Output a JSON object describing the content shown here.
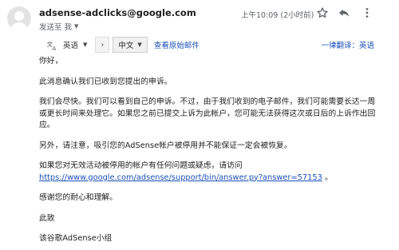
{
  "email": {
    "sender": "adsense-adclicks@google.com",
    "to_line": "发送至 我",
    "time": "上午10:09 (2小时前)"
  },
  "icons": {
    "star": "star-icon",
    "reply": "reply-icon",
    "more": "more-vert-icon",
    "translate": "translate-icon"
  },
  "translate_bar": {
    "source_lang": "英语",
    "arrow": "›",
    "target_lang": "中文",
    "show_original": "查看原始邮件",
    "always_translate": "一律翻译：英语"
  },
  "body": {
    "greeting": "你好，",
    "p1": "此消息确认我们已收到您提出的申诉。",
    "p2": "我们会尽快。我们可以看到自己的申诉。不过，由于我们收到的电子邮件，我们可能需要长达一周或更长时间来处理它。如果您之前已提交上诉为此帐户，您可能无法获得这次或日后的上诉作出回应。",
    "p3": "另外，请注意，吸引您的AdSense帐户被停用并不能保证一定会被恢复。",
    "p4": "如果您对无效活动被停用的帐户有任何问题或疑虑，请访问",
    "p4_link": "https://www.google.com/adsense/support/bin/answer.py?answer=57153",
    "p4_tail": " 。",
    "thanks": "感谢您的耐心和理解。",
    "closing": "此致",
    "signature": "该谷歌AdSense小组"
  },
  "colors": {
    "link": "#1a4fb7",
    "muted": "#5f6368"
  }
}
